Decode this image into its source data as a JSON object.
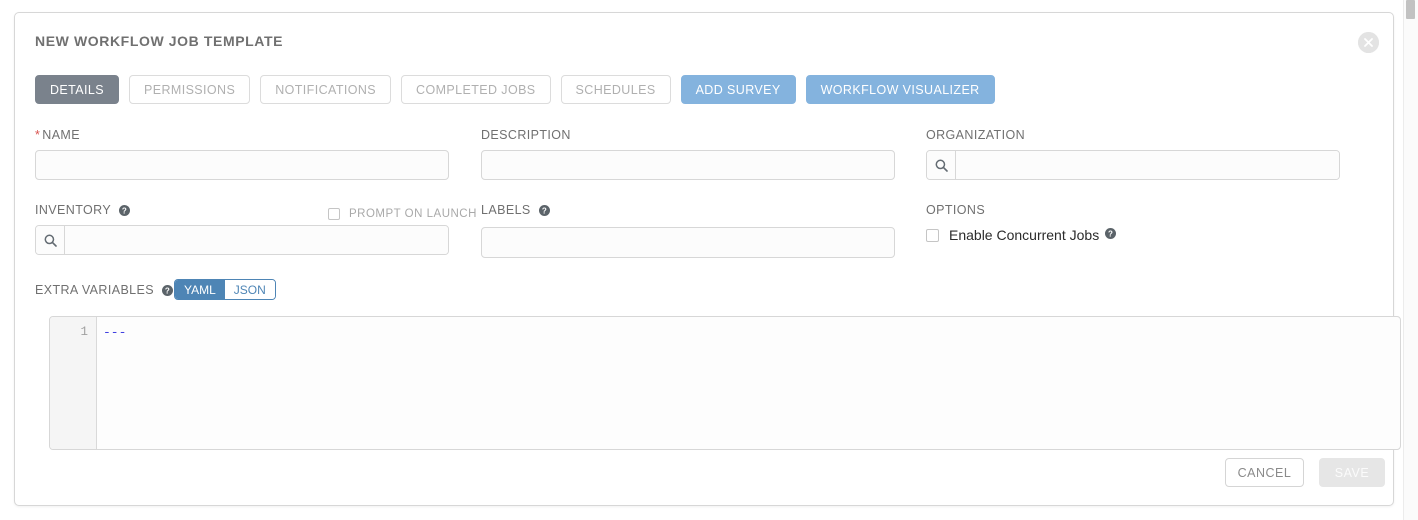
{
  "panel": {
    "title": "NEW WORKFLOW JOB TEMPLATE",
    "close_icon": "close-circle-icon"
  },
  "tabs": [
    {
      "label": "DETAILS",
      "state": "active"
    },
    {
      "label": "PERMISSIONS",
      "state": "inactive"
    },
    {
      "label": "NOTIFICATIONS",
      "state": "inactive"
    },
    {
      "label": "COMPLETED JOBS",
      "state": "inactive"
    },
    {
      "label": "SCHEDULES",
      "state": "inactive"
    },
    {
      "label": "ADD SURVEY",
      "state": "primary"
    },
    {
      "label": "WORKFLOW VISUALIZER",
      "state": "primary"
    }
  ],
  "fields": {
    "name": {
      "label": "NAME",
      "required": true,
      "value": "",
      "placeholder": ""
    },
    "description": {
      "label": "DESCRIPTION",
      "value": "",
      "placeholder": ""
    },
    "organization": {
      "label": "ORGANIZATION",
      "value": "",
      "placeholder": "",
      "icon": "search-icon"
    },
    "inventory": {
      "label": "INVENTORY",
      "value": "",
      "placeholder": "",
      "icon": "search-icon",
      "help": "help-icon"
    },
    "labels": {
      "label": "LABELS",
      "value": "",
      "placeholder": "",
      "help": "help-icon"
    },
    "options": {
      "label": "OPTIONS"
    }
  },
  "checkboxes": {
    "prompt_on_launch": {
      "label": "PROMPT ON LAUNCH",
      "checked": false
    },
    "enable_concurrent_jobs": {
      "label": "Enable Concurrent Jobs",
      "checked": false,
      "help": "help-icon"
    }
  },
  "extra_variables": {
    "label": "EXTRA VARIABLES",
    "help": "help-icon",
    "format_options": [
      {
        "label": "YAML",
        "selected": true
      },
      {
        "label": "JSON",
        "selected": false
      }
    ],
    "line_numbers": "1",
    "content": "---"
  },
  "footer": {
    "cancel_label": "CANCEL",
    "save_label": "SAVE",
    "save_disabled": true
  },
  "colors": {
    "accent_blue": "#84b3de",
    "toggle_blue": "#4e85b5",
    "active_tab_gray": "#7a828c",
    "required_red": "#d9534f",
    "code_text": "#4040e0"
  }
}
